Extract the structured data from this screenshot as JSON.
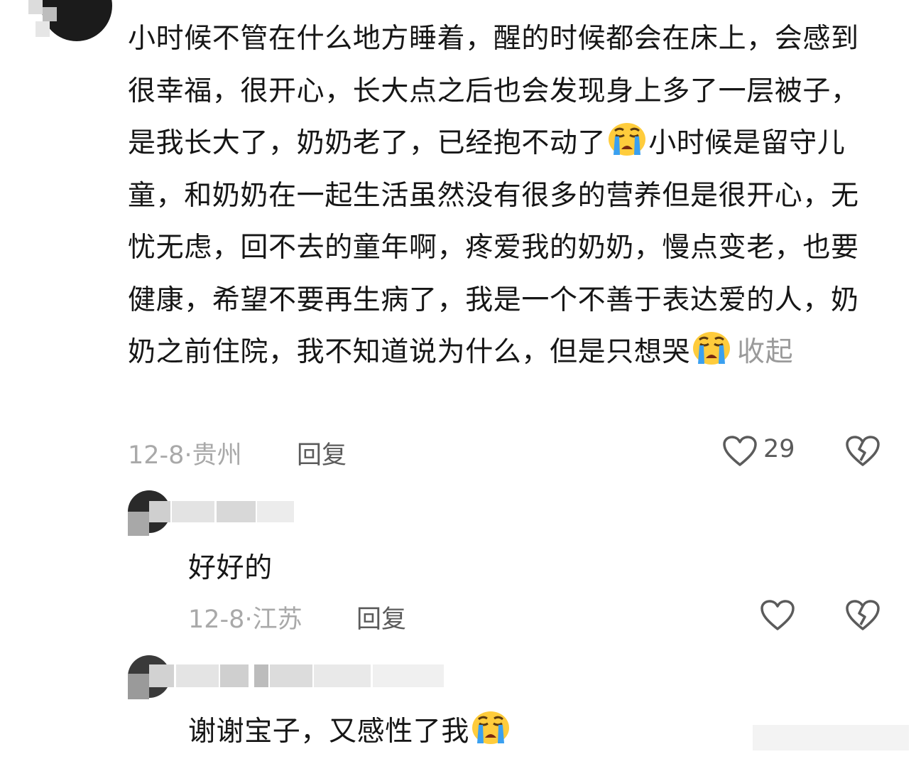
{
  "comment": {
    "text": "小时候不管在什么地方睡着，醒的时候都会在床上，会感到很幸福，很开心，长大点之后也会发现身上多了一层被子，是我长大了，奶奶老了，已经抱不动了",
    "emoji": "loudly-crying-face",
    "text2": "小时候是留守儿童，和奶奶在一起生活虽然没有很多的营养但是很开心，无忧无虑，回不去的童年啊，疼爱我的奶奶，慢点变老，也要健康，希望不要再生病了，我是一个不善于表达爱的人，奶奶之前住院，我不知道说为什么，但是只想哭",
    "collapse_label": "收起",
    "date": "12-8",
    "location": "贵州",
    "reply_label": "回复",
    "like_count": "29"
  },
  "replies": [
    {
      "text": "好好的",
      "date": "12-8",
      "location": "江苏",
      "reply_label": "回复"
    },
    {
      "text": "谢谢宝子，又感性了我",
      "emoji": "loudly-crying-face"
    }
  ],
  "icons": {
    "like": "heart-outline-icon",
    "dislike": "broken-heart-icon"
  },
  "colors": {
    "text": "#161616",
    "meta": "#a9a9a9",
    "action": "#5b5b5b"
  }
}
